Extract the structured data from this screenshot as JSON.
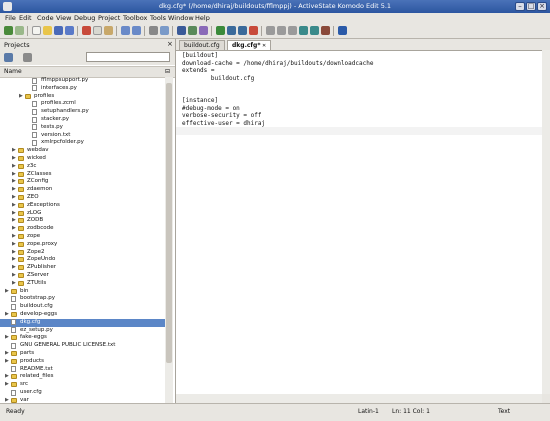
{
  "window": {
    "title": "dkg.cfg* (/home/dhiraj/buildouts/fflmppj) - ActiveState Komodo Edit 5.1"
  },
  "menu": [
    "File",
    "Edit",
    "Code",
    "View",
    "Debug",
    "Project",
    "Toolbox",
    "Tools",
    "Window",
    "Help"
  ],
  "left_panel": {
    "title": "Projects",
    "column_header": "Name",
    "tree": [
      {
        "indent": 4,
        "kind": "file",
        "label": "fflmppsupport.py"
      },
      {
        "indent": 4,
        "kind": "file",
        "label": "interfaces.py"
      },
      {
        "indent": 3,
        "kind": "folder",
        "expander": "▶",
        "label": "profiles"
      },
      {
        "indent": 4,
        "kind": "file",
        "label": "profiles.zcml"
      },
      {
        "indent": 4,
        "kind": "file",
        "label": "setuphandlers.py"
      },
      {
        "indent": 4,
        "kind": "file",
        "label": "stacker.py"
      },
      {
        "indent": 4,
        "kind": "file",
        "label": "tests.py"
      },
      {
        "indent": 4,
        "kind": "file",
        "label": "version.txt"
      },
      {
        "indent": 4,
        "kind": "file",
        "label": "xmlrpcfolder.py"
      },
      {
        "indent": 2,
        "kind": "folder",
        "expander": "▶",
        "label": "webdav"
      },
      {
        "indent": 2,
        "kind": "folder",
        "expander": "▶",
        "label": "wicked"
      },
      {
        "indent": 2,
        "kind": "folder",
        "expander": "▶",
        "label": "z3c"
      },
      {
        "indent": 2,
        "kind": "folder",
        "expander": "▶",
        "label": "ZClasses"
      },
      {
        "indent": 2,
        "kind": "folder",
        "expander": "▶",
        "label": "ZConfig"
      },
      {
        "indent": 2,
        "kind": "folder",
        "expander": "▶",
        "label": "zdaemon"
      },
      {
        "indent": 2,
        "kind": "folder",
        "expander": "▶",
        "label": "ZEO"
      },
      {
        "indent": 2,
        "kind": "folder",
        "expander": "▶",
        "label": "zExceptions"
      },
      {
        "indent": 2,
        "kind": "folder",
        "expander": "▶",
        "label": "zLOG"
      },
      {
        "indent": 2,
        "kind": "folder",
        "expander": "▶",
        "label": "ZODB"
      },
      {
        "indent": 2,
        "kind": "folder",
        "expander": "▶",
        "label": "zodbcode"
      },
      {
        "indent": 2,
        "kind": "folder",
        "expander": "▶",
        "label": "zope"
      },
      {
        "indent": 2,
        "kind": "folder",
        "expander": "▶",
        "label": "zope.proxy"
      },
      {
        "indent": 2,
        "kind": "folder",
        "expander": "▶",
        "label": "Zope2"
      },
      {
        "indent": 2,
        "kind": "folder",
        "expander": "▶",
        "label": "ZopeUndo"
      },
      {
        "indent": 2,
        "kind": "folder",
        "expander": "▶",
        "label": "ZPublisher"
      },
      {
        "indent": 2,
        "kind": "folder",
        "expander": "▶",
        "label": "ZServer"
      },
      {
        "indent": 2,
        "kind": "folder",
        "expander": "▶",
        "label": "ZTUtils"
      },
      {
        "indent": 1,
        "kind": "folder",
        "expander": "▶",
        "label": "bin"
      },
      {
        "indent": 1,
        "kind": "file",
        "label": "bootstrap.py"
      },
      {
        "indent": 1,
        "kind": "file",
        "label": "buildout.cfg"
      },
      {
        "indent": 1,
        "kind": "folder",
        "expander": "▶",
        "label": "develop-eggs"
      },
      {
        "indent": 1,
        "kind": "file",
        "label": "dkg.cfg",
        "selected": true
      },
      {
        "indent": 1,
        "kind": "file",
        "label": "ez_setup.py"
      },
      {
        "indent": 1,
        "kind": "folder",
        "expander": "▶",
        "label": "fake-eggs"
      },
      {
        "indent": 1,
        "kind": "file",
        "label": "GNU GENERAL PUBLIC LICENSE.txt"
      },
      {
        "indent": 1,
        "kind": "folder",
        "expander": "▶",
        "label": "parts"
      },
      {
        "indent": 1,
        "kind": "folder",
        "expander": "▶",
        "label": "products"
      },
      {
        "indent": 1,
        "kind": "file",
        "label": "README.txt"
      },
      {
        "indent": 1,
        "kind": "folder",
        "expander": "▶",
        "label": "related_files"
      },
      {
        "indent": 1,
        "kind": "folder",
        "expander": "▶",
        "label": "src"
      },
      {
        "indent": 1,
        "kind": "file",
        "label": "user.cfg"
      },
      {
        "indent": 1,
        "kind": "folder",
        "expander": "▶",
        "label": "var"
      }
    ]
  },
  "tabs": [
    {
      "label": "buildout.cfg",
      "active": false
    },
    {
      "label": "dkg.cfg*",
      "active": true,
      "close": "✕"
    }
  ],
  "editor": {
    "lines": [
      "[buildout]",
      "download-cache = /home/dhiraj/buildouts/downloadcache",
      "extends =",
      "        buildout.cfg",
      "",
      "",
      "[instance]",
      "#debug-mode = on",
      "verbose-security = off",
      "effective-user = dhiraj",
      ""
    ],
    "current_line_index": 10
  },
  "status": {
    "left": "Ready",
    "encoding": "Latin-1",
    "position": "Ln: 11 Col: 1",
    "filetype": "Text"
  },
  "colors": {
    "selection": "#5b86c7",
    "folder": "#e9c54a",
    "titlebar": "#2c56a0"
  }
}
